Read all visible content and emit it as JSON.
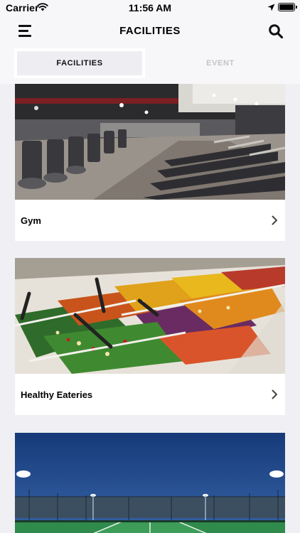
{
  "status_bar": {
    "carrier": "Carrier",
    "time": "11:56 AM"
  },
  "nav": {
    "title": "FACILITIES",
    "left_icon": "hamburger-menu-icon",
    "right_icon": "search-icon"
  },
  "tabs": [
    {
      "label": "FACILITIES",
      "selected": true
    },
    {
      "label": "EVENT",
      "selected": false
    }
  ],
  "facilities": [
    {
      "label": "Gym",
      "image": "gym-photo"
    },
    {
      "label": "Healthy Eateries",
      "image": "salad-bar-photo"
    },
    {
      "label": "",
      "image": "tennis-court-photo"
    }
  ],
  "colors": {
    "background": "#efeff4",
    "card": "#ffffff",
    "inactive_tab_text": "#c4c4c8",
    "tennis_court_green": "#2f8a4c",
    "night_sky": "#1f4a8a"
  }
}
